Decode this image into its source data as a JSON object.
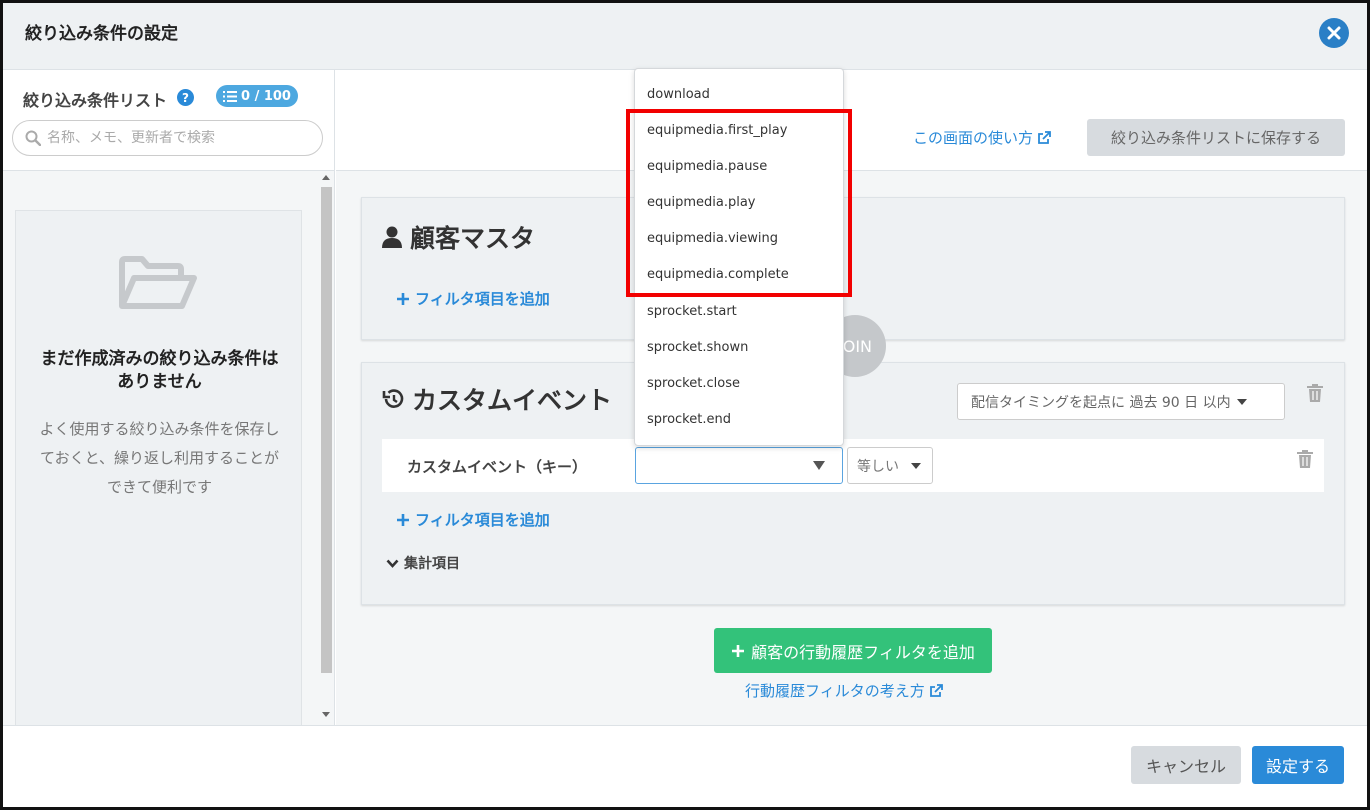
{
  "header": {
    "title": "絞り込み条件の設定"
  },
  "left_panel": {
    "title": "絞り込み条件リスト",
    "count_badge": "0 / 100",
    "search_placeholder": "名称、メモ、更新者で検索",
    "empty_title": "まだ作成済みの絞り込み条件はありません",
    "empty_desc": "よく使用する絞り込み条件を保存しておくと、繰り返し利用することができて便利です"
  },
  "toolbar": {
    "howto_link": "この画面の使い方",
    "save_list_button": "絞り込み条件リストに保存する"
  },
  "customer_master": {
    "title": "顧客マスタ",
    "add_filter": "フィルタ項目を追加"
  },
  "custom_event": {
    "title": "カスタムイベント",
    "timing_select": "配信タイミングを起点に 過去 90 日 以内",
    "row_label": "カスタムイベント（キー）",
    "key_value": "",
    "operator": "等しい",
    "add_filter": "フィルタ項目を追加",
    "aggregation_toggle": "集計項目"
  },
  "join_label": "JOIN",
  "add_behavior_button": "顧客の行動履歴フィルタを追加",
  "behavior_link": "行動履歴フィルタの考え方",
  "footer": {
    "cancel": "キャンセル",
    "apply": "設定する"
  },
  "dropdown": {
    "items": [
      "download",
      "equipmedia.first_play",
      "equipmedia.pause",
      "equipmedia.play",
      "equipmedia.viewing",
      "equipmedia.complete",
      "sprocket.start",
      "sprocket.shown",
      "sprocket.close",
      "sprocket.end"
    ]
  },
  "colors": {
    "accent": "#2a8ad8",
    "success": "#33c27a",
    "highlight": "#f20000"
  }
}
